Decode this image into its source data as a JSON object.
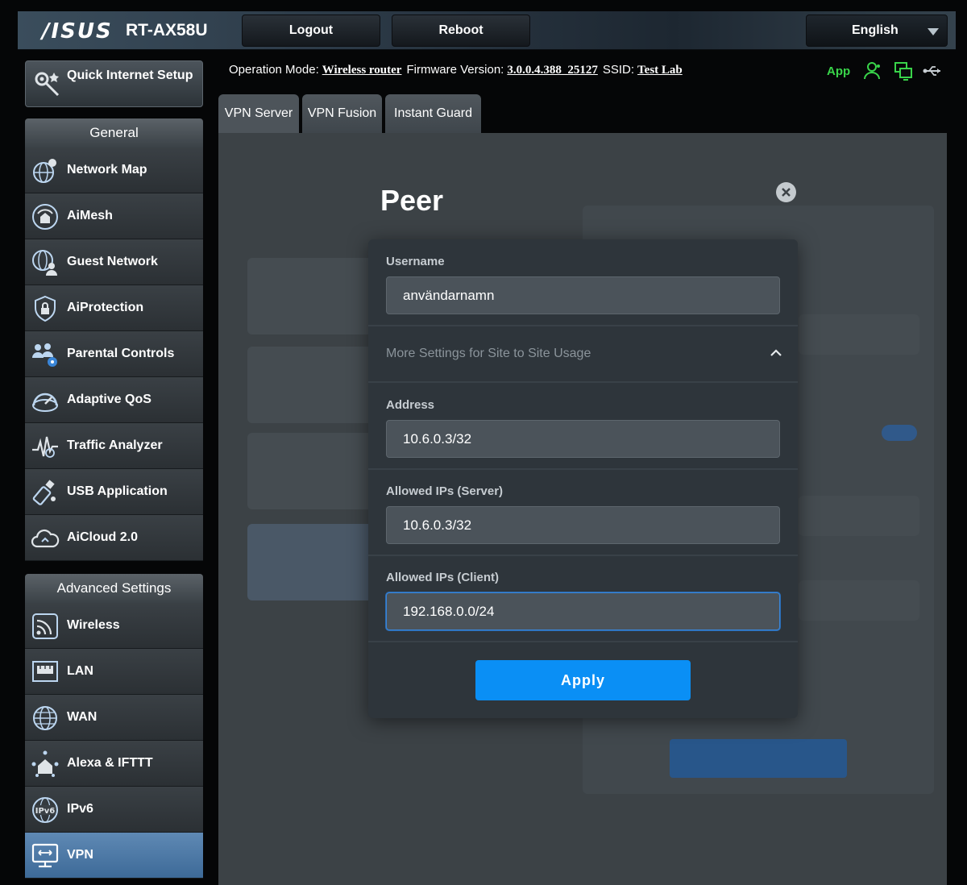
{
  "header": {
    "brand": "/ISUS",
    "model": "RT-AX58U",
    "logout_label": "Logout",
    "reboot_label": "Reboot",
    "language": "English"
  },
  "sidebar": {
    "quick_setup_label": "Quick Internet Setup",
    "general_header": "General",
    "general_items": [
      {
        "label": "Network Map",
        "icon": "globe-pin-icon"
      },
      {
        "label": "AiMesh",
        "icon": "mesh-icon"
      },
      {
        "label": "Guest Network",
        "icon": "guest-globe-icon"
      },
      {
        "label": "AiProtection",
        "icon": "lock-shield-icon"
      },
      {
        "label": "Parental Controls",
        "icon": "family-icon"
      },
      {
        "label": "Adaptive QoS",
        "icon": "gauge-icon"
      },
      {
        "label": "Traffic Analyzer",
        "icon": "pulse-icon"
      },
      {
        "label": "USB Application",
        "icon": "usb-drive-icon"
      },
      {
        "label": "AiCloud 2.0",
        "icon": "cloud-icon"
      }
    ],
    "advanced_header": "Advanced Settings",
    "advanced_items": [
      {
        "label": "Wireless",
        "icon": "wifi-icon"
      },
      {
        "label": "LAN",
        "icon": "lan-icon"
      },
      {
        "label": "WAN",
        "icon": "wan-globe-icon"
      },
      {
        "label": "Alexa & IFTTT",
        "icon": "smart-home-icon"
      },
      {
        "label": "IPv6",
        "icon": "ipv6-icon"
      },
      {
        "label": "VPN",
        "icon": "vpn-monitor-icon"
      }
    ],
    "active_item": "VPN"
  },
  "status_bar": {
    "operation_mode_label": "Operation Mode:",
    "operation_mode_value": "Wireless router",
    "firmware_label": "Firmware Version:",
    "firmware_value": "3.0.0.4.388_25127",
    "ssid_label": "SSID:",
    "ssid_value": "Test Lab",
    "app_label": "App"
  },
  "tabs": [
    "VPN Server",
    "VPN Fusion",
    "Instant Guard"
  ],
  "active_tab": "VPN Server",
  "modal": {
    "title": "Peer",
    "username_label": "Username",
    "username_value": "användarnamn",
    "more_settings_label": "More Settings for Site to Site Usage",
    "address_label": "Address",
    "address_value": "10.6.0.3/32",
    "allowed_server_label": "Allowed IPs (Server)",
    "allowed_server_value": "10.6.0.3/32",
    "allowed_client_label": "Allowed IPs (Client)",
    "allowed_client_value": "192.168.0.0/24",
    "apply_label": "Apply"
  },
  "colors": {
    "accent": "#0a8ff5",
    "active_menu": "#4f7aa6",
    "app_green": "#39d44a"
  }
}
